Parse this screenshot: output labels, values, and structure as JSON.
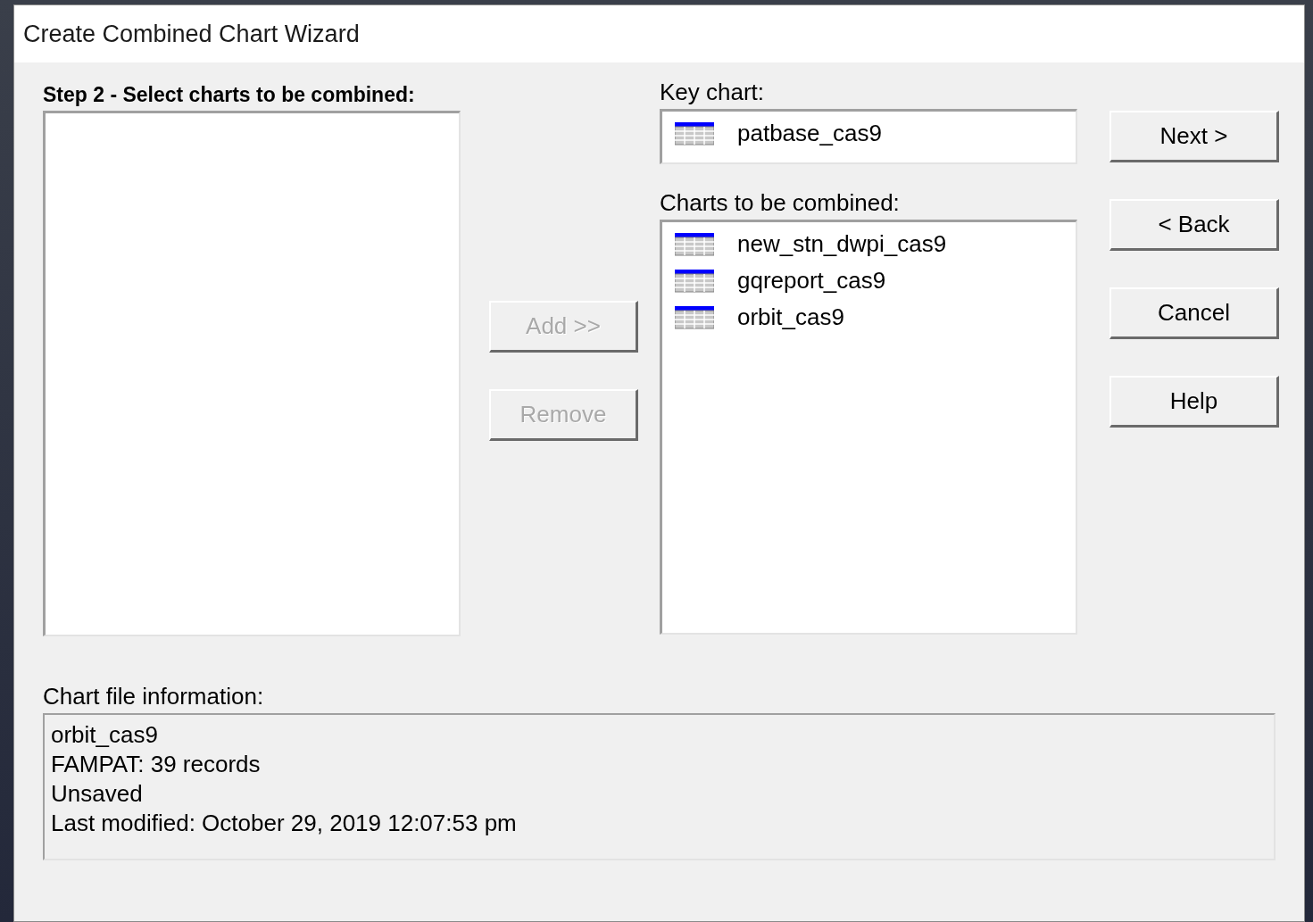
{
  "window": {
    "title": "Create Combined Chart Wizard"
  },
  "step_heading": "Step 2 - Select charts to be combined:",
  "middle_buttons": [
    {
      "label": "Add >>",
      "disabled": true
    },
    {
      "label": "Remove",
      "disabled": true
    }
  ],
  "key_chart": {
    "label": "Key chart:",
    "item": "patbase_cas9"
  },
  "charts_to_combine": {
    "label": "Charts to be combined:",
    "items": [
      "new_stn_dwpi_cas9",
      "gqreport_cas9",
      "orbit_cas9"
    ]
  },
  "side_buttons": [
    {
      "label": "Next >",
      "disabled": false
    },
    {
      "label": "< Back",
      "disabled": false
    },
    {
      "label": "Cancel",
      "disabled": false
    },
    {
      "label": "Help",
      "disabled": false
    }
  ],
  "file_info": {
    "label": "Chart file information:",
    "lines": [
      "orbit_cas9",
      "FAMPAT: 39 records",
      "Unsaved",
      "Last modified: October 29, 2019 12:07:53 pm"
    ]
  }
}
